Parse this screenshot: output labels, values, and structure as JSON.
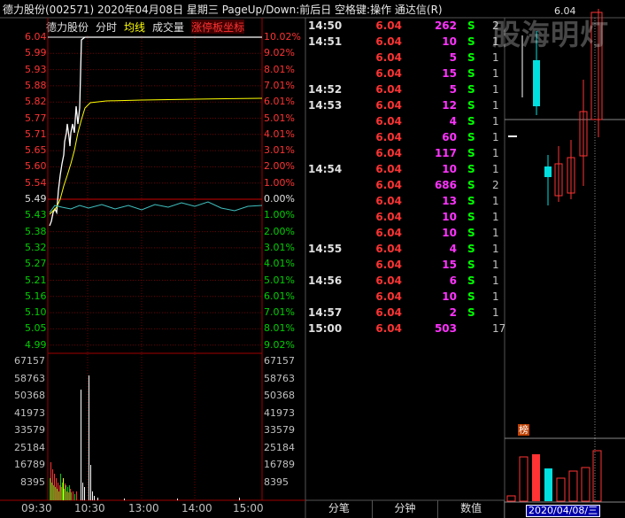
{
  "header": {
    "title": "德力股份(002571)  2020年04月08日 星期三 PageUp/Down:前后日 空格键:操作 通达信(R)"
  },
  "tabs": {
    "name": "德力股份",
    "fenshi": "分时",
    "junxian": "均线",
    "chengjiaoliang": "成交量",
    "zhangting": "涨停板坐标"
  },
  "price_axis": {
    "labels": [
      "6.04",
      "5.99",
      "5.93",
      "5.88",
      "5.82",
      "5.77",
      "5.71",
      "5.65",
      "5.60",
      "5.54",
      "5.49",
      "5.43",
      "5.38",
      "5.32",
      "5.27",
      "5.21",
      "5.16",
      "5.10",
      "5.05",
      "4.99"
    ],
    "pct": [
      "10.02%",
      "9.02%",
      "8.01%",
      "7.01%",
      "6.01%",
      "5.01%",
      "4.01%",
      "3.01%",
      "2.00%",
      "1.00%",
      "0.00%",
      "1.00%",
      "2.00%",
      "3.01%",
      "4.01%",
      "5.01%",
      "6.01%",
      "7.01%",
      "8.01%",
      "9.02%"
    ]
  },
  "volume_axis": {
    "labels": [
      "67157",
      "58763",
      "50368",
      "41973",
      "33579",
      "25184",
      "16789",
      "8395"
    ]
  },
  "time_axis": [
    "09:30",
    "10:30",
    "13:00",
    "14:00",
    "15:00"
  ],
  "chart_data": {
    "type": "line",
    "series": [
      {
        "values": [
          5.45,
          5.4,
          5.48,
          5.52,
          5.58,
          5.64,
          5.68,
          5.72,
          5.78,
          5.76,
          5.82,
          5.8,
          5.85,
          5.86,
          6.04,
          6.04,
          6.04,
          6.04,
          6.04,
          6.04,
          6.04,
          6.04,
          6.04,
          6.04,
          6.04,
          6.04,
          6.04,
          6.04,
          6.04,
          6.04
        ]
      },
      {
        "values": [
          5.45,
          5.43,
          5.45,
          5.48,
          5.52,
          5.55,
          5.58,
          5.61,
          5.64,
          5.67,
          5.7,
          5.72,
          5.75,
          5.77,
          5.79,
          5.81,
          5.82,
          5.825,
          5.83,
          5.83,
          5.835,
          5.835,
          5.84,
          5.84,
          5.84,
          5.845,
          5.845,
          5.85,
          5.85,
          5.85
        ]
      }
    ],
    "ylim": [
      4.99,
      6.04
    ]
  },
  "ticks": [
    {
      "time": "14:50",
      "price": "6.04",
      "vol": "262",
      "side": "S",
      "num": "2"
    },
    {
      "time": "14:51",
      "price": "6.04",
      "vol": "10",
      "side": "S",
      "num": "1"
    },
    {
      "time": "",
      "price": "6.04",
      "vol": "5",
      "side": "S",
      "num": "1"
    },
    {
      "time": "",
      "price": "6.04",
      "vol": "15",
      "side": "S",
      "num": "1"
    },
    {
      "time": "14:52",
      "price": "6.04",
      "vol": "5",
      "side": "S",
      "num": "1"
    },
    {
      "time": "14:53",
      "price": "6.04",
      "vol": "12",
      "side": "S",
      "num": "1"
    },
    {
      "time": "",
      "price": "6.04",
      "vol": "4",
      "side": "S",
      "num": "1"
    },
    {
      "time": "",
      "price": "6.04",
      "vol": "60",
      "side": "S",
      "num": "1"
    },
    {
      "time": "",
      "price": "6.04",
      "vol": "117",
      "side": "S",
      "num": "1"
    },
    {
      "time": "14:54",
      "price": "6.04",
      "vol": "10",
      "side": "S",
      "num": "1"
    },
    {
      "time": "",
      "price": "6.04",
      "vol": "686",
      "side": "S",
      "num": "2"
    },
    {
      "time": "",
      "price": "6.04",
      "vol": "13",
      "side": "S",
      "num": "1"
    },
    {
      "time": "",
      "price": "6.04",
      "vol": "10",
      "side": "S",
      "num": "1"
    },
    {
      "time": "",
      "price": "6.04",
      "vol": "10",
      "side": "S",
      "num": "1"
    },
    {
      "time": "14:55",
      "price": "6.04",
      "vol": "4",
      "side": "S",
      "num": "1"
    },
    {
      "time": "",
      "price": "6.04",
      "vol": "15",
      "side": "S",
      "num": "1"
    },
    {
      "time": "14:56",
      "price": "6.04",
      "vol": "6",
      "side": "S",
      "num": "1"
    },
    {
      "time": "",
      "price": "6.04",
      "vol": "10",
      "side": "S",
      "num": "1"
    },
    {
      "time": "14:57",
      "price": "6.04",
      "vol": "2",
      "side": "S",
      "num": "1"
    },
    {
      "time": "15:00",
      "price": "6.04",
      "vol": "503",
      "side": "",
      "num": "17"
    }
  ],
  "bottom_tabs": [
    "分笔",
    "分钟",
    "数值"
  ],
  "kline": {
    "price_label": "6.04",
    "badge": "榜",
    "date": "2020/04/08/三",
    "watermark": "股海明灯"
  }
}
